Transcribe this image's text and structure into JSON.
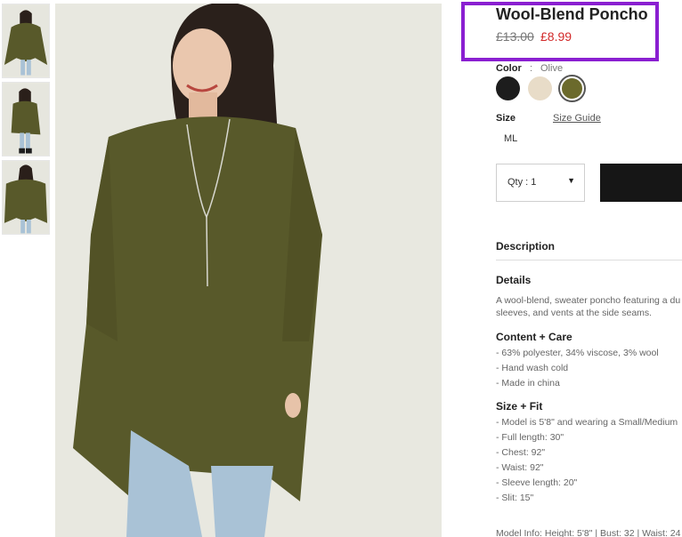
{
  "product": {
    "title": "Wool-Blend Poncho",
    "price_original": "£13.00",
    "price_sale": "£8.99"
  },
  "color": {
    "label": "Color",
    "separator": ":",
    "selected": "Olive",
    "swatches": [
      {
        "name": "black",
        "hex": "#1d1d1d"
      },
      {
        "name": "cream",
        "hex": "#e8dcc8"
      },
      {
        "name": "olive",
        "hex": "#6b6a2c"
      }
    ]
  },
  "size": {
    "label": "Size",
    "guide_label": "Size Guide",
    "options": [
      "ML"
    ]
  },
  "quantity": {
    "label": "Qty : 1"
  },
  "description": {
    "heading": "Description",
    "details_heading": "Details",
    "details_text": [
      "A wool-blend, sweater poncho featuring a du",
      "sleeves, and vents at the side seams."
    ],
    "content_heading": "Content + Care",
    "content_items": [
      "- 63% polyester, 34% viscose, 3% wool",
      "- Hand wash cold",
      "- Made in china"
    ],
    "size_fit_heading": "Size + Fit",
    "size_fit_items": [
      "- Model is 5'8\" and wearing a Small/Medium",
      "- Full length: 30\"",
      "- Chest: 92\"",
      "- Waist: 92\"",
      "- Sleeve length: 20\"",
      "- Slit: 15\""
    ],
    "model_info": "Model Info: Height: 5'8\" | Bust: 32 | Waist: 24"
  },
  "colors": {
    "accent_outline": "#8a1fd1",
    "sale_price": "#d22a2a",
    "poncho_olive": "#58592a"
  }
}
